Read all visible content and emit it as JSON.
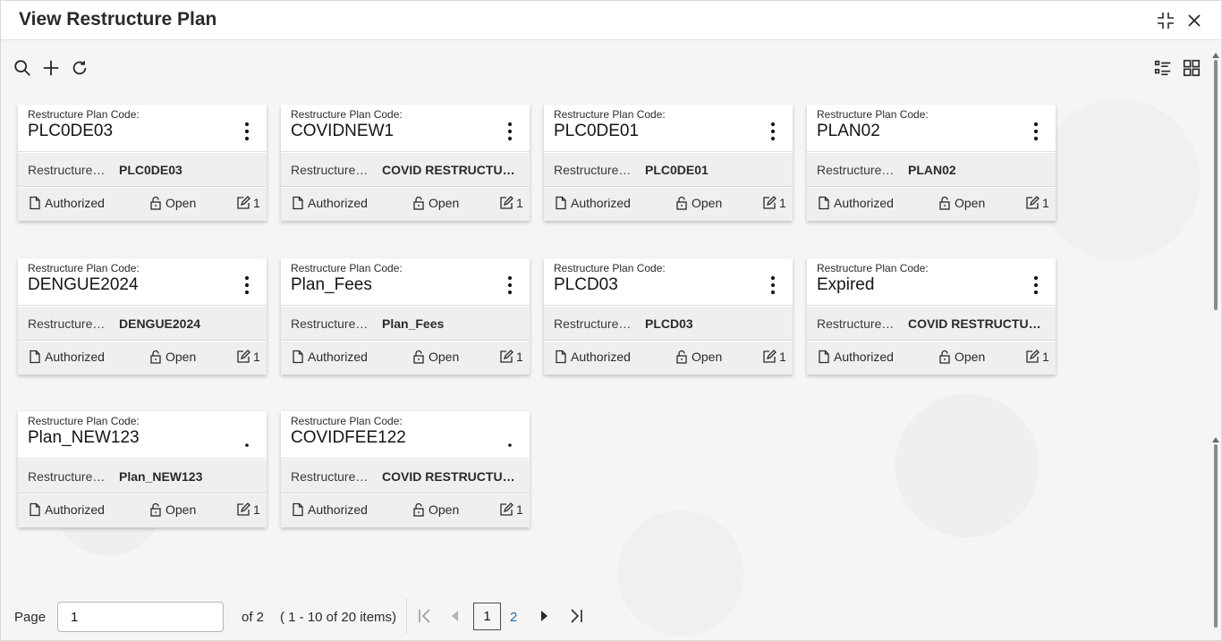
{
  "window": {
    "title": "View Restructure Plan"
  },
  "toolbar": {
    "search_icon": "search-icon",
    "add_icon": "plus-icon",
    "refresh_icon": "refresh-icon",
    "list_view_icon": "list-view-icon",
    "grid_view_icon": "grid-view-icon"
  },
  "cards": [
    {
      "label": "Restructure Plan Code:",
      "code": "PLC0DE03",
      "desc_label": "Restructure…",
      "desc_value": "PLC0DE03",
      "status": "Authorized",
      "lock": "Open",
      "edit_count": "1",
      "menu": "⋮"
    },
    {
      "label": "Restructure Plan Code:",
      "code": "COVIDNEW1",
      "desc_label": "Restructure…",
      "desc_value": "COVID RESTRUCTUR…",
      "status": "Authorized",
      "lock": "Open",
      "edit_count": "1",
      "menu": "⋮"
    },
    {
      "label": "Restructure Plan Code:",
      "code": "PLC0DE01",
      "desc_label": "Restructure…",
      "desc_value": "PLC0DE01",
      "status": "Authorized",
      "lock": "Open",
      "edit_count": "1",
      "menu": "⋮"
    },
    {
      "label": "Restructure Plan Code:",
      "code": "PLAN02",
      "desc_label": "Restructure…",
      "desc_value": "PLAN02",
      "status": "Authorized",
      "lock": "Open",
      "edit_count": "1",
      "menu": "⋮"
    },
    {
      "label": "Restructure Plan Code:",
      "code": "DENGUE2024",
      "desc_label": "Restructure…",
      "desc_value": "DENGUE2024",
      "status": "Authorized",
      "lock": "Open",
      "edit_count": "1",
      "menu": "⋮"
    },
    {
      "label": "Restructure Plan Code:",
      "code": "Plan_Fees",
      "desc_label": "Restructure…",
      "desc_value": "Plan_Fees",
      "status": "Authorized",
      "lock": "Open",
      "edit_count": "1",
      "menu": "⋮"
    },
    {
      "label": "Restructure Plan Code:",
      "code": "PLCD03",
      "desc_label": "Restructure…",
      "desc_value": "PLCD03",
      "status": "Authorized",
      "lock": "Open",
      "edit_count": "1",
      "menu": "⋮"
    },
    {
      "label": "Restructure Plan Code:",
      "code": "Expired",
      "desc_label": "Restructure…",
      "desc_value": "COVID RESTRUCTUR…",
      "status": "Authorized",
      "lock": "Open",
      "edit_count": "1",
      "menu": "⋮"
    },
    {
      "label": "Restructure Plan Code:",
      "code": "Plan_NEW123",
      "desc_label": "Restructure…",
      "desc_value": "Plan_NEW123",
      "status": "Authorized",
      "lock": "Open",
      "edit_count": "1",
      "menu": "."
    },
    {
      "label": "Restructure Plan Code:",
      "code": "COVIDFEE122",
      "desc_label": "Restructure…",
      "desc_value": "COVID RESTRUCTUR…",
      "status": "Authorized",
      "lock": "Open",
      "edit_count": "1",
      "menu": "."
    }
  ],
  "pager": {
    "page_label": "Page",
    "page_value": "1",
    "of_text": "of 2",
    "range_text": "( 1 - 10 of 20 items)",
    "current_page": "1",
    "next_page": "2"
  }
}
